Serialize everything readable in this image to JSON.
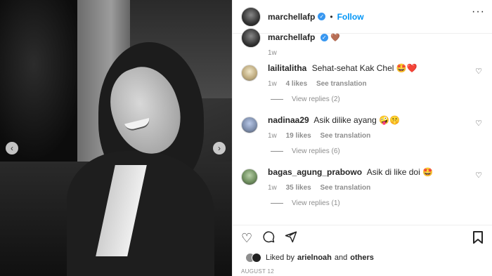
{
  "post": {
    "username": "marchellafp",
    "follow_label": "Follow",
    "caption_emoji": "🤎",
    "caption_time": "1w"
  },
  "comments": [
    {
      "username": "lailitalitha",
      "text": "Sehat-sehat Kak Chel 🤩❤️",
      "time": "1w",
      "likes": "4 likes",
      "translate": "See translation",
      "replies": "View replies (2)"
    },
    {
      "username": "nadinaa29",
      "text": "Asik dilike ayang 🤪🤫",
      "time": "1w",
      "likes": "19 likes",
      "translate": "See translation",
      "replies": "View replies (6)"
    },
    {
      "username": "bagas_agung_prabowo",
      "text": "Asik di like doi 🤩",
      "time": "1w",
      "likes": "35 likes",
      "translate": "See translation",
      "replies": "View replies (1)"
    }
  ],
  "liked_by": {
    "prefix": "Liked by",
    "user": "arielnoah",
    "and": "and",
    "others": "others"
  },
  "date": "AUGUST 12",
  "icons": {
    "more": "more-icon",
    "like": "heart-icon",
    "comment": "comment-icon",
    "share": "share-icon",
    "save": "bookmark-icon",
    "verified": "verified-badge-icon",
    "carousel_prev": "chevron-left-icon",
    "carousel_next": "chevron-right-icon"
  },
  "colors": {
    "follow": "#0095f6",
    "verified": "#3897f0",
    "muted": "#8e8e8e"
  }
}
